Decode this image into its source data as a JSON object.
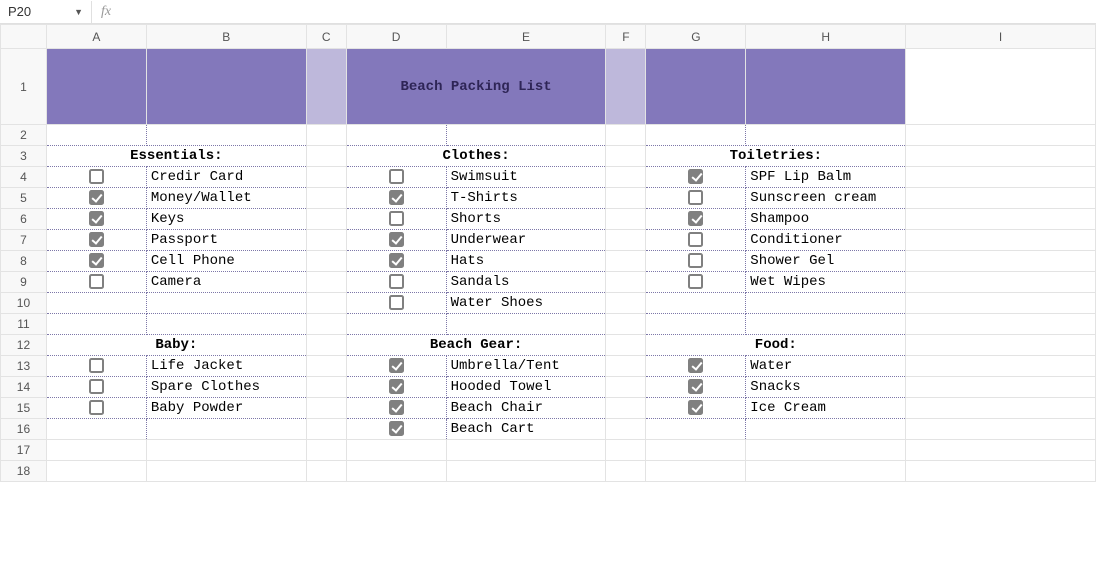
{
  "nameBox": {
    "ref": "P20"
  },
  "fxLabel": "fx",
  "formulaValue": "",
  "columns": [
    "A",
    "B",
    "C",
    "D",
    "E",
    "F",
    "G",
    "H",
    "I"
  ],
  "rows": [
    "1",
    "2",
    "3",
    "4",
    "5",
    "6",
    "7",
    "8",
    "9",
    "10",
    "11",
    "12",
    "13",
    "14",
    "15",
    "16",
    "17",
    "18"
  ],
  "title": "Beach Packing List",
  "sections": {
    "essentials": {
      "header": "Essentials:",
      "items": [
        {
          "label": "Credir Card",
          "checked": false
        },
        {
          "label": "Money/Wallet",
          "checked": true
        },
        {
          "label": "Keys",
          "checked": true
        },
        {
          "label": "Passport",
          "checked": true
        },
        {
          "label": "Cell Phone",
          "checked": true
        },
        {
          "label": "Camera",
          "checked": false
        }
      ]
    },
    "clothes": {
      "header": "Clothes:",
      "items": [
        {
          "label": "Swimsuit",
          "checked": false
        },
        {
          "label": "T-Shirts",
          "checked": true
        },
        {
          "label": "Shorts",
          "checked": false
        },
        {
          "label": "Underwear",
          "checked": true
        },
        {
          "label": "Hats",
          "checked": true
        },
        {
          "label": "Sandals",
          "checked": false
        },
        {
          "label": "Water Shoes",
          "checked": false
        }
      ]
    },
    "toiletries": {
      "header": "Toiletries:",
      "items": [
        {
          "label": "SPF Lip Balm",
          "checked": true
        },
        {
          "label": "Sunscreen cream",
          "checked": false
        },
        {
          "label": "Shampoo",
          "checked": true
        },
        {
          "label": "Conditioner",
          "checked": false
        },
        {
          "label": "Shower Gel",
          "checked": false
        },
        {
          "label": "Wet Wipes",
          "checked": false
        }
      ]
    },
    "baby": {
      "header": "Baby:",
      "items": [
        {
          "label": "Life Jacket",
          "checked": false
        },
        {
          "label": "Spare Clothes",
          "checked": false
        },
        {
          "label": "Baby Powder",
          "checked": false
        }
      ]
    },
    "beachGear": {
      "header": "Beach Gear:",
      "items": [
        {
          "label": "Umbrella/Tent",
          "checked": true
        },
        {
          "label": "Hooded Towel",
          "checked": true
        },
        {
          "label": "Beach Chair",
          "checked": true
        },
        {
          "label": "Beach Cart",
          "checked": true
        }
      ]
    },
    "food": {
      "header": "Food:",
      "items": [
        {
          "label": "Water",
          "checked": true
        },
        {
          "label": "Snacks",
          "checked": true
        },
        {
          "label": "Ice Cream",
          "checked": true
        }
      ]
    }
  }
}
